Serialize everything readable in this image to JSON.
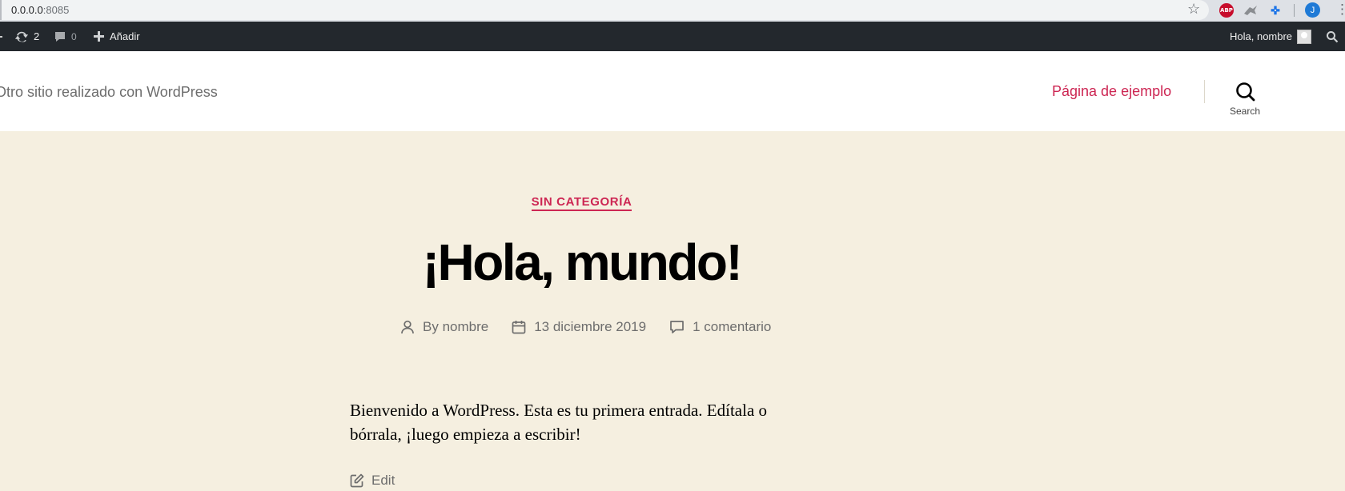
{
  "browser": {
    "url_host": "0.0.0.0",
    "url_port": ":8085",
    "extensions": {
      "abp_label": "ABP"
    },
    "profile_initial": "J"
  },
  "admin_bar": {
    "updates_count": "2",
    "comments_count": "0",
    "new_label": "Añadir",
    "greeting": "Hola, nombre"
  },
  "header": {
    "tagline": "Otro sitio realizado con WordPress",
    "nav_link": "Página de ejemplo",
    "search_label": "Search"
  },
  "post": {
    "category": "SIN CATEGORÍA",
    "title": "¡Hola, mundo!",
    "meta": {
      "author_prefix": "By ",
      "author": "nombre",
      "date": "13 diciembre 2019",
      "comments": "1 comentario"
    },
    "excerpt": "Bienvenido a WordPress. Esta es tu primera entrada. Edítala o bórrala, ¡luego empieza a escribir!",
    "edit_label": "Edit"
  },
  "colors": {
    "accent": "#cd2653",
    "admin_bar_bg": "#23282d",
    "content_bg": "#f5efe0",
    "meta_text": "#6d6d6d"
  },
  "icons": {
    "updates": "refresh-icon",
    "comments": "comment-bubble-icon",
    "new": "plus-icon",
    "search": "search-icon",
    "author": "user-icon",
    "date": "calendar-icon",
    "comment_meta": "comment-icon",
    "edit": "edit-icon"
  }
}
